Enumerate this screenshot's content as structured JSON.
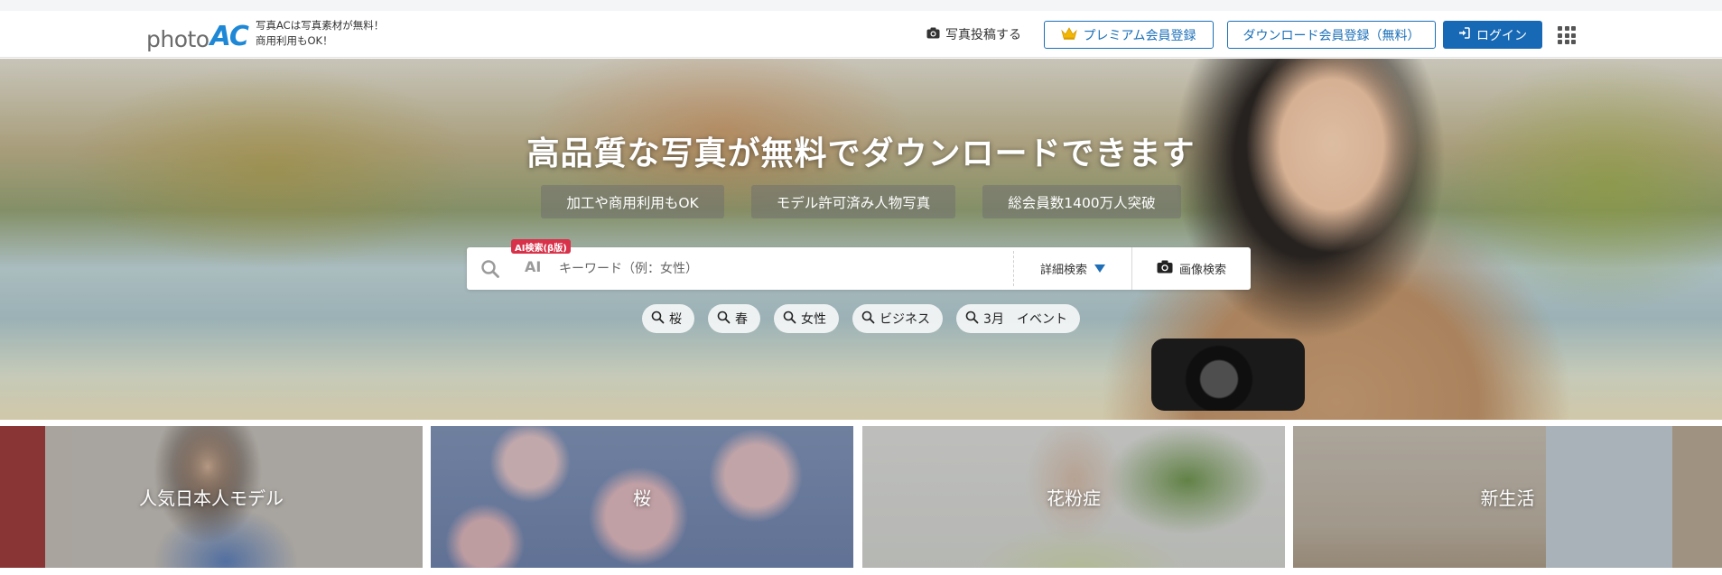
{
  "header": {
    "logo_photo": "photo",
    "logo_ac": "AC",
    "tagline_line1": "写真ACは写真素材が無料！",
    "tagline_line2": "商用利用もOK！",
    "post_label": "写真投稿する",
    "premium_label": "プレミアム会員登録",
    "download_register_label": "ダウンロード会員登録（無料）",
    "login_label": "ログイン"
  },
  "hero": {
    "title": "高品質な写真が無料でダウンロードできます",
    "features": [
      "加工や商用利用もOK",
      "モデル許可済み人物写真",
      "総会員数1400万人突破"
    ],
    "search": {
      "ai_badge": "AI検索(β版)",
      "ai_label": "AI",
      "placeholder": "キーワード（例：女性）",
      "value": "",
      "advanced_label": "詳細検索",
      "image_search_label": "画像検索"
    },
    "tags": [
      "桜",
      "春",
      "女性",
      "ビジネス",
      "3月　イベント"
    ]
  },
  "categories": [
    {
      "label": "人気日本人モデル"
    },
    {
      "label": "桜"
    },
    {
      "label": "花粉症"
    },
    {
      "label": "新生活"
    }
  ],
  "colors": {
    "brand_blue": "#1869b5",
    "ai_badge_red": "#d8324a",
    "crown_gold": "#f2b705"
  }
}
